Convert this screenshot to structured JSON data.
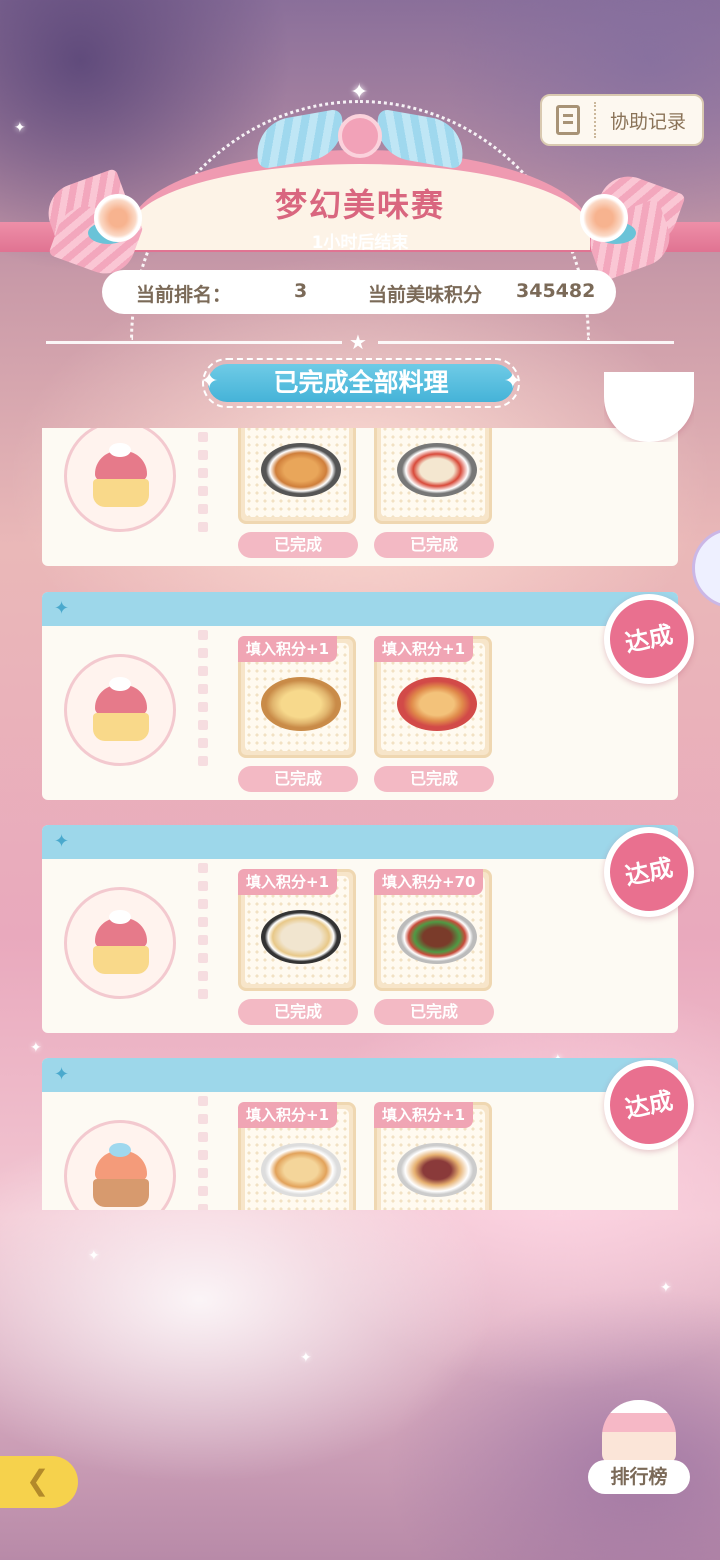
{
  "header": {
    "title": "梦幻美味赛",
    "subtitle": "1小时后结束",
    "assist_label": "协助记录"
  },
  "rank_bar": {
    "rank_label": "当前排名：",
    "rank_value": "3",
    "score_label": "当前美味积分",
    "score_value": "345482"
  },
  "completed_banner": "已完成全部料理",
  "cards": [
    {
      "dishes": [
        {
          "tag": "",
          "status": "已完成",
          "icon": "stir-fry-dish-icon"
        },
        {
          "tag": "",
          "status": "已完成",
          "icon": "chili-tofu-dish-icon"
        }
      ]
    },
    {
      "badge": "达成",
      "dishes": [
        {
          "tag": "填入积分+1",
          "status": "已完成",
          "icon": "cheese-board-dish-icon"
        },
        {
          "tag": "填入积分+1",
          "status": "已完成",
          "icon": "noodle-bowl-dish-icon"
        }
      ]
    },
    {
      "badge": "达成",
      "dishes": [
        {
          "tag": "填入积分+1",
          "status": "已完成",
          "icon": "soup-bowl-dish-icon"
        },
        {
          "tag": "填入积分+70",
          "status": "已完成",
          "icon": "pepper-meat-dish-icon"
        }
      ]
    },
    {
      "badge": "达成",
      "dishes": [
        {
          "tag": "填入积分+1",
          "status": "",
          "icon": "braised-dish-icon"
        },
        {
          "tag": "填入积分+1",
          "status": "",
          "icon": "mixed-stew-dish-icon"
        }
      ]
    }
  ],
  "leaderboard_label": "排行榜",
  "colors": {
    "accent_pink": "#e9708f",
    "accent_blue": "#45b3d8",
    "title_pink": "#d9667f"
  }
}
